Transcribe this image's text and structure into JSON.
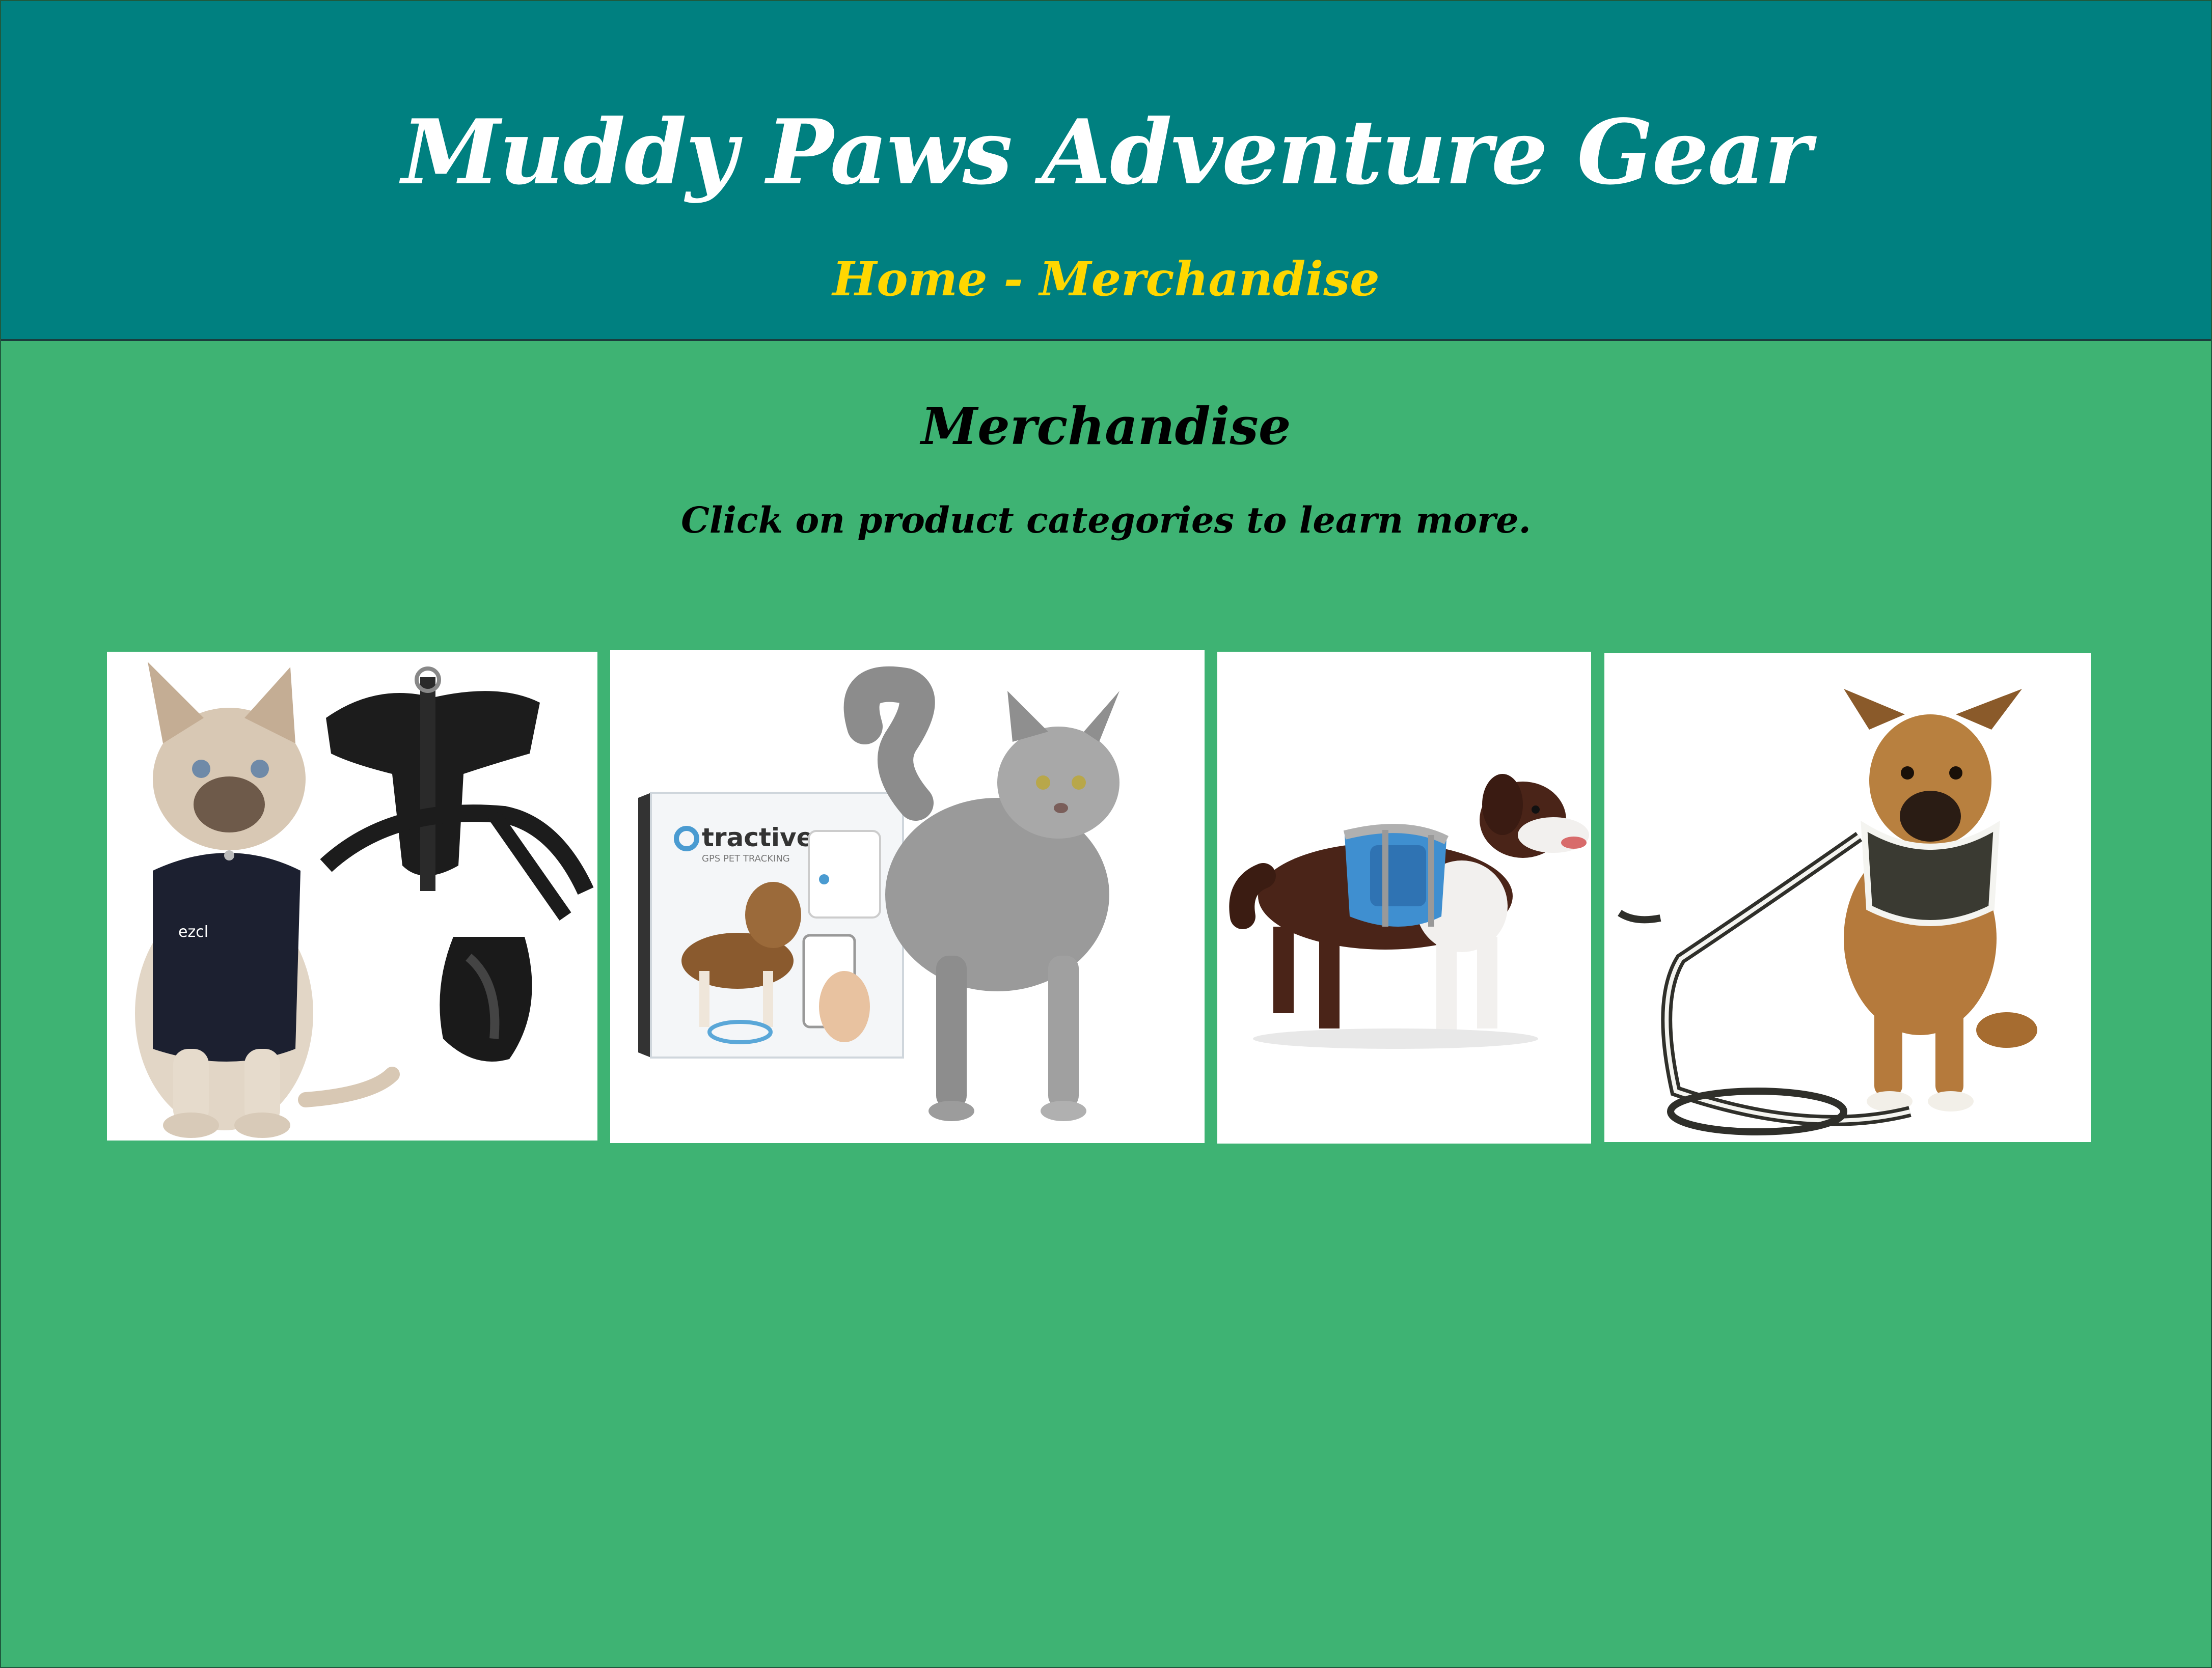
{
  "header": {
    "site_title": "Muddy Paws Adventure Gear",
    "breadcrumb": {
      "home_label": "Home",
      "separator": " - ",
      "current_label": "Merchandise"
    }
  },
  "main": {
    "title": "Merchandise",
    "subtitle": "Click on product categories to learn more."
  },
  "products": [
    {
      "name": "cat-harness",
      "brand_text": "ezcl"
    },
    {
      "name": "gps-tracker",
      "brand_text": "tractive",
      "box_caption": "GPS PET TRACKING"
    },
    {
      "name": "dog-backpack"
    },
    {
      "name": "dog-harness-leash"
    }
  ],
  "colors": {
    "header_bg": "#008080",
    "page_bg": "#3eb373",
    "title_text": "#ffffff",
    "breadcrumb_text": "#ffd700",
    "body_text": "#000000"
  }
}
